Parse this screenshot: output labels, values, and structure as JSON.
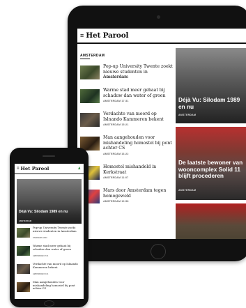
{
  "tablet": {
    "logo": "Het Parool",
    "menu_icon": "≡",
    "section": "AMSTERDAM",
    "items": [
      {
        "title": "Pop-up University Twente zoekt nieuwe studenten in Amsterdam",
        "meta": "STADSGIDS  18:30"
      },
      {
        "title": "Warme stad meer gebaat bij schaduw dan water of groen",
        "meta": "AMSTERDAM  17:31"
      },
      {
        "title": "Verdachte van moord op Islnando Kammeron bekent",
        "meta": "AMSTERDAM  15:21"
      },
      {
        "title": "Man aangehouden voor mishandeling homostel bij pont achter CS",
        "meta": "AMSTERDAM  16:22"
      },
      {
        "title": "Homostel mishandeld in Kerkstraat",
        "meta": "AMSTERDAM  11:07"
      },
      {
        "title": "Mars door Amsterdam tegen homogeweld",
        "meta": "AMSTERDAM  10:58"
      }
    ],
    "cards": [
      {
        "title": "Déjà Vu: Silodam 1989 en nu",
        "meta": "AMSTERDAM"
      },
      {
        "title": "De laatste bewoner van wooncomplex Solid 11 blijft procederen",
        "meta": "AMSTERDAM"
      },
      {
        "title": "",
        "meta": ""
      }
    ]
  },
  "phone": {
    "logo": "Het Parool",
    "menu_icon": "≡",
    "user_icon": "♟",
    "hero": {
      "title": "Déjà Vu: Silodam 1989 en nu",
      "meta": "AMSTERDAM"
    },
    "items": [
      {
        "title": "Pop-up University Twente zoekt nieuwe studenten in Amsterdam",
        "meta": "STADSGIDS  18:30"
      },
      {
        "title": "Warme stad meer gebaat bij schaduw dan water of groen",
        "meta": "AMSTERDAM  17:31"
      },
      {
        "title": "Verdachte van moord op Islnando Kammeron bekent",
        "meta": "AMSTERDAM  15:21"
      },
      {
        "title": "Man aangehouden voor mishandeling homostel bij pont achter CS",
        "meta": "AMSTERDAM  16:22"
      }
    ]
  }
}
